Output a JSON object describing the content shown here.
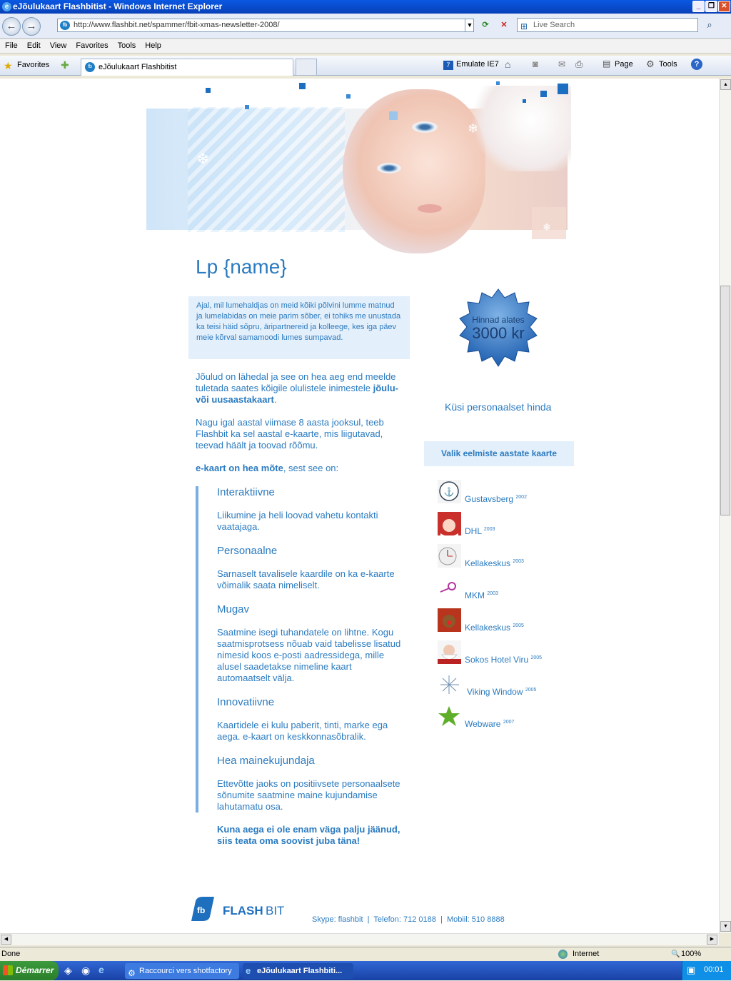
{
  "window": {
    "title": "eJõulukaart Flashbitist - Windows Internet Explorer",
    "url": "http://www.flashbit.net/spammer/fbit-xmas-newsletter-2008/",
    "search_placeholder": "Live Search"
  },
  "menu": [
    "File",
    "Edit",
    "View",
    "Favorites",
    "Tools",
    "Help"
  ],
  "favbar": {
    "favorites": "Favorites",
    "tab_title": "eJõulukaart Flashbitist",
    "emulate": "Emulate IE7",
    "page": "Page",
    "tools": "Tools"
  },
  "page": {
    "greeting": "Lp {name}",
    "intro": "Ajal, mil lumehaldjas on meid kõiki põlvini lumme matnud ja lumelabidas on meie parim sõber, ei tohiks me unustada ka teisi häid sõpru, äripartnereid ja kolleege, kes iga päev meie kõrval samamoodi lumes sumpavad.",
    "p1_start": "Jõulud on lähedal ja see on hea aeg end meelde tuletada saates kõigile olulistele inimestele ",
    "p1_bold": "jõulu- või uusaastakaart",
    "p1_end": ".",
    "p2": "Nagu igal aastal viimase 8 aasta jooksul, teeb Flashbit ka sel aastal e-kaarte, mis liigutavad, teevad häält ja toovad rõõmu.",
    "p3_bold": "e-kaart on hea mõte",
    "p3_end": ", sest see on:",
    "features": [
      {
        "title": "Interaktiivne",
        "text": "Liikumine ja heli loovad vahetu kontakti vaatajaga."
      },
      {
        "title": "Personaalne",
        "text": "Sarnaselt tavalisele kaardile on ka e-kaarte võimalik saata nimeliselt."
      },
      {
        "title": "Mugav",
        "text": "Saatmine isegi tuhandatele on lihtne. Kogu saatmisprotsess nõuab vaid tabelisse lisatud nimesid koos e-posti aadressidega, mille alusel saadetakse nimeline kaart automaatselt välja."
      },
      {
        "title": "Innovatiivne",
        "text": "Kaartidele ei kulu paberit, tinti, marke ega aega. e-kaart on keskkonnasõbralik."
      },
      {
        "title": "Hea mainekujundaja",
        "text": "Ettevõtte jaoks on positiivsete personaalsete sõnumite saatmine maine kujundamise lahutamatu osa."
      }
    ],
    "cta": "Kuna aega ei ole enam väga palju jäänud, siis teata oma soovist juba täna!",
    "badge_line1": "Hinnad alates",
    "badge_line2": "3000 kr",
    "ask": "Küsi personaalset hinda",
    "prev_heading": "Valik eelmiste aastate kaarte",
    "cards": [
      {
        "name": "Gustavsberg",
        "year": "2002",
        "icon": "gustavsberg-logo"
      },
      {
        "name": "DHL",
        "year": "2003",
        "icon": "santa-thumbnail"
      },
      {
        "name": "Kellakeskus",
        "year": "2003",
        "icon": "clock-thumbnail"
      },
      {
        "name": "MKM",
        "year": "2003",
        "icon": "ornament-thumbnail"
      },
      {
        "name": "Kellakeskus",
        "year": "2005",
        "icon": "reindeer-thumbnail"
      },
      {
        "name": "Sokos Hotel Viru",
        "year": "2005",
        "icon": "santa-face-thumbnail"
      },
      {
        "name": "Viking Window",
        "year": "2005",
        "icon": "snowflake-thumbnail"
      },
      {
        "name": "Webware",
        "year": "2007",
        "icon": "green-star-thumbnail"
      }
    ],
    "logo_text_bold": "FLASH",
    "logo_text_light": "BIT",
    "contact": "Skype: flashbit  |  Telefon: 712 0188  |  Mobiil: 510 8888"
  },
  "status": {
    "left": "Done",
    "zone": "Internet",
    "zoom": "100%"
  },
  "taskbar": {
    "start": "Démarrer",
    "task1": "Raccourci vers shotfactory",
    "task2": "eJõulukaart Flashbiti...",
    "clock": "00:01"
  },
  "colors": {
    "brand_blue": "#2b7bc0",
    "light_panel": "#e3effb"
  }
}
